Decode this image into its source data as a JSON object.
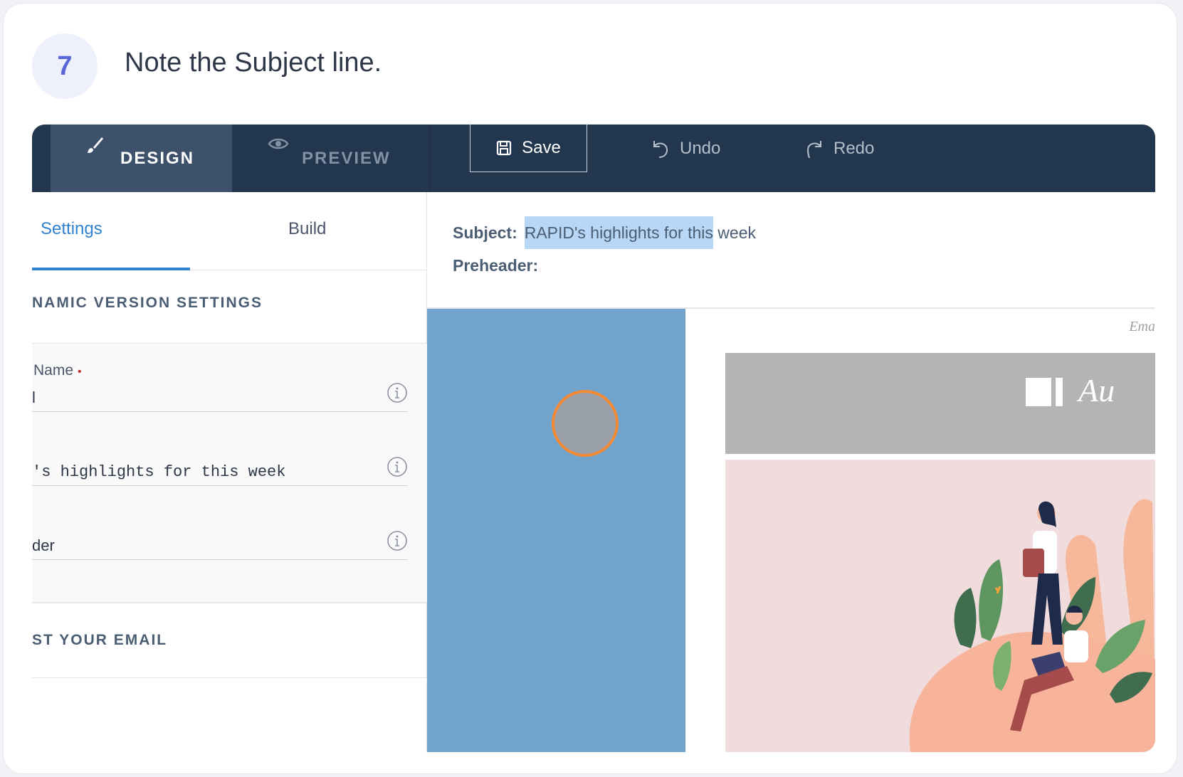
{
  "step": {
    "number": "7",
    "title": "Note the Subject line."
  },
  "toolbar": {
    "design_label": "DESIGN",
    "preview_label": "PREVIEW",
    "save_label": "Save",
    "undo_label": "Undo",
    "redo_label": "Redo"
  },
  "sidebar": {
    "tabs": [
      {
        "label": "Settings",
        "active": true
      },
      {
        "label": "Build",
        "active": false
      }
    ],
    "dynamic_section_title": "NAMIC VERSION SETTINGS",
    "name_label": "Name",
    "required_mark": "•",
    "name_value": "l",
    "subject_value": "'s highlights for this week",
    "preheader_value": "der",
    "test_section_title": "ST YOUR EMAIL"
  },
  "preview": {
    "subject_key": "Subject:",
    "subject_highlighted": "RAPID's highlights for this",
    "subject_rest": " week",
    "preheader_key": "Preheader:",
    "email_hint": "Ema",
    "logo_text": "Au"
  },
  "colors": {
    "toolbar_bg": "#22374d",
    "accent": "#3182ce",
    "selection": "#b8d6f5",
    "cursor_ring": "#f58a35"
  }
}
